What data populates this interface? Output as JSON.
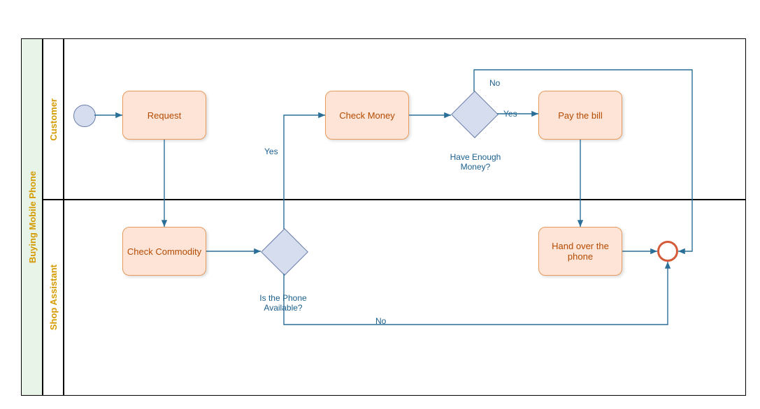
{
  "pool": {
    "title": "Buying Mobile Phone"
  },
  "lanes": {
    "customer": "Customer",
    "assistant": "Shop Assistant"
  },
  "tasks": {
    "request": "Request",
    "check_commodity": "Check Commodity",
    "check_money": "Check Money",
    "pay_bill": "Pay the bill",
    "hand_over": "Hand over the phone"
  },
  "gateways": {
    "phone_available": "Is the Phone Available?",
    "enough_money": "Have Enough Money?"
  },
  "edges": {
    "yes1": "Yes",
    "no1": "No",
    "yes2": "Yes",
    "no2": "No"
  },
  "colors": {
    "lane_title_bg": "#e8f4e8",
    "task_fill": "#fde4d6",
    "task_border": "#e89b5c",
    "gateway_fill": "#d6ddee",
    "edge": "#2a6f97",
    "end_border": "#d45a3a"
  }
}
